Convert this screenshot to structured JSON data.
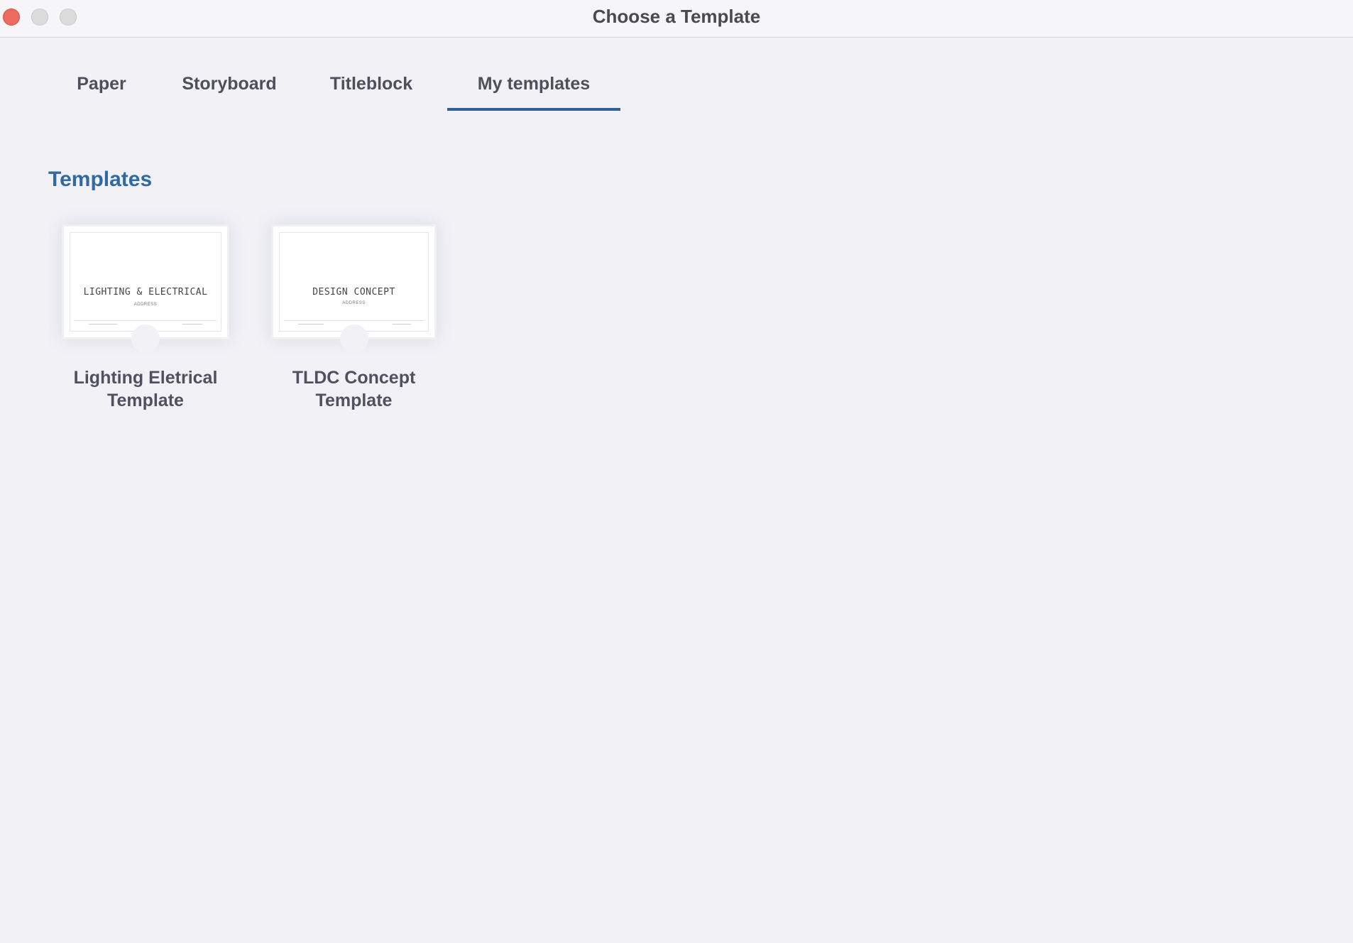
{
  "window": {
    "title": "Choose a Template"
  },
  "tabs": [
    {
      "label": "Paper",
      "active": false
    },
    {
      "label": "Storyboard",
      "active": false
    },
    {
      "label": "Titleblock",
      "active": false
    },
    {
      "label": "My templates",
      "active": true
    }
  ],
  "section": {
    "title": "Templates"
  },
  "templates": [
    {
      "label_line1": "Lighting Eletrical",
      "label_line2": "Template",
      "thumb_heading": "LIGHTING & ELECTRICAL",
      "thumb_sub": "ADDRESS"
    },
    {
      "label_line1": "TLDC Concept",
      "label_line2": "Template",
      "thumb_heading": "DESIGN CONCEPT",
      "thumb_sub": "ADDRESS"
    }
  ],
  "colors": {
    "accent": "#2f6aa5",
    "tab_underline": "#2f5f9c",
    "close_button": "#ec6a5e",
    "background": "#f1f1f6"
  }
}
